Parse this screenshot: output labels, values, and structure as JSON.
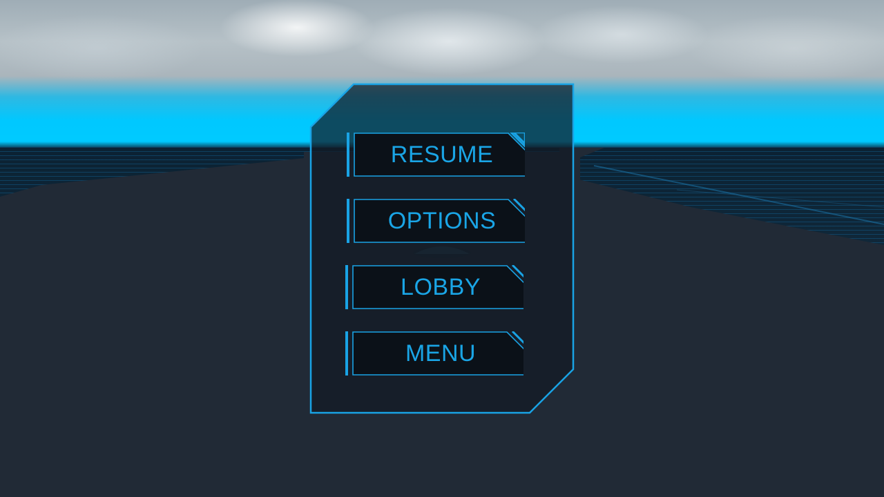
{
  "pause_menu": {
    "buttons": [
      {
        "id": "resume",
        "label": "RESUME"
      },
      {
        "id": "options",
        "label": "OPTIONS"
      },
      {
        "id": "lobby",
        "label": "LOBBY"
      },
      {
        "id": "menu",
        "label": "MENU"
      }
    ]
  },
  "colors": {
    "accent": "#19a3e5",
    "panel_fill": "#141b25",
    "button_fill": "#0b1118",
    "horizon_glow": "#00c8ff",
    "ground": "#212a36"
  }
}
